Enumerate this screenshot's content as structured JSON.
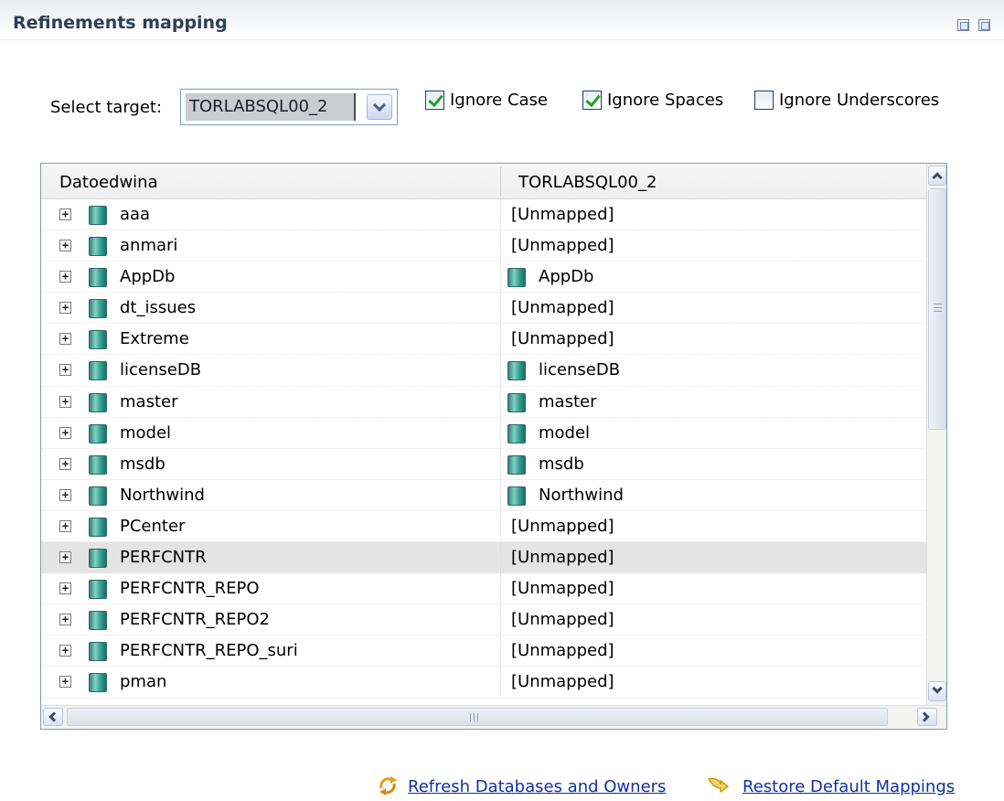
{
  "header": {
    "title": "Refinements mapping"
  },
  "target": {
    "label": "Select target:",
    "value": "TORLABSQL00_2"
  },
  "options": {
    "ignore_case": {
      "label": "Ignore Case",
      "checked": true
    },
    "ignore_spaces": {
      "label": "Ignore Spaces",
      "checked": true
    },
    "ignore_underscores": {
      "label": "Ignore Underscores",
      "checked": false
    }
  },
  "table": {
    "columns": [
      "Datoedwina",
      "TORLABSQL00_2"
    ],
    "rows": [
      {
        "name": "aaa",
        "target": "[Unmapped]",
        "mapped": false
      },
      {
        "name": "anmari",
        "target": "[Unmapped]",
        "mapped": false
      },
      {
        "name": "AppDb",
        "target": "AppDb",
        "mapped": true
      },
      {
        "name": "dt_issues",
        "target": "[Unmapped]",
        "mapped": false
      },
      {
        "name": "Extreme",
        "target": "[Unmapped]",
        "mapped": false
      },
      {
        "name": "licenseDB",
        "target": "licenseDB",
        "mapped": true
      },
      {
        "name": "master",
        "target": "master",
        "mapped": true
      },
      {
        "name": "model",
        "target": "model",
        "mapped": true
      },
      {
        "name": "msdb",
        "target": "msdb",
        "mapped": true
      },
      {
        "name": "Northwind",
        "target": "Northwind",
        "mapped": true
      },
      {
        "name": "PCenter",
        "target": "[Unmapped]",
        "mapped": false
      },
      {
        "name": "PERFCNTR",
        "target": "[Unmapped]",
        "mapped": false,
        "selected": true
      },
      {
        "name": "PERFCNTR_REPO",
        "target": "[Unmapped]",
        "mapped": false
      },
      {
        "name": "PERFCNTR_REPO2",
        "target": "[Unmapped]",
        "mapped": false
      },
      {
        "name": "PERFCNTR_REPO_suri",
        "target": "[Unmapped]",
        "mapped": false
      },
      {
        "name": "pman",
        "target": "[Unmapped]",
        "mapped": false
      }
    ]
  },
  "links": {
    "refresh": "Refresh Databases and Owners",
    "restore": "Restore Default Mappings"
  },
  "icons": {
    "database": "database-icon",
    "expand": "expand-plus-icon",
    "refresh": "refresh-icon",
    "restore": "restore-icon"
  }
}
